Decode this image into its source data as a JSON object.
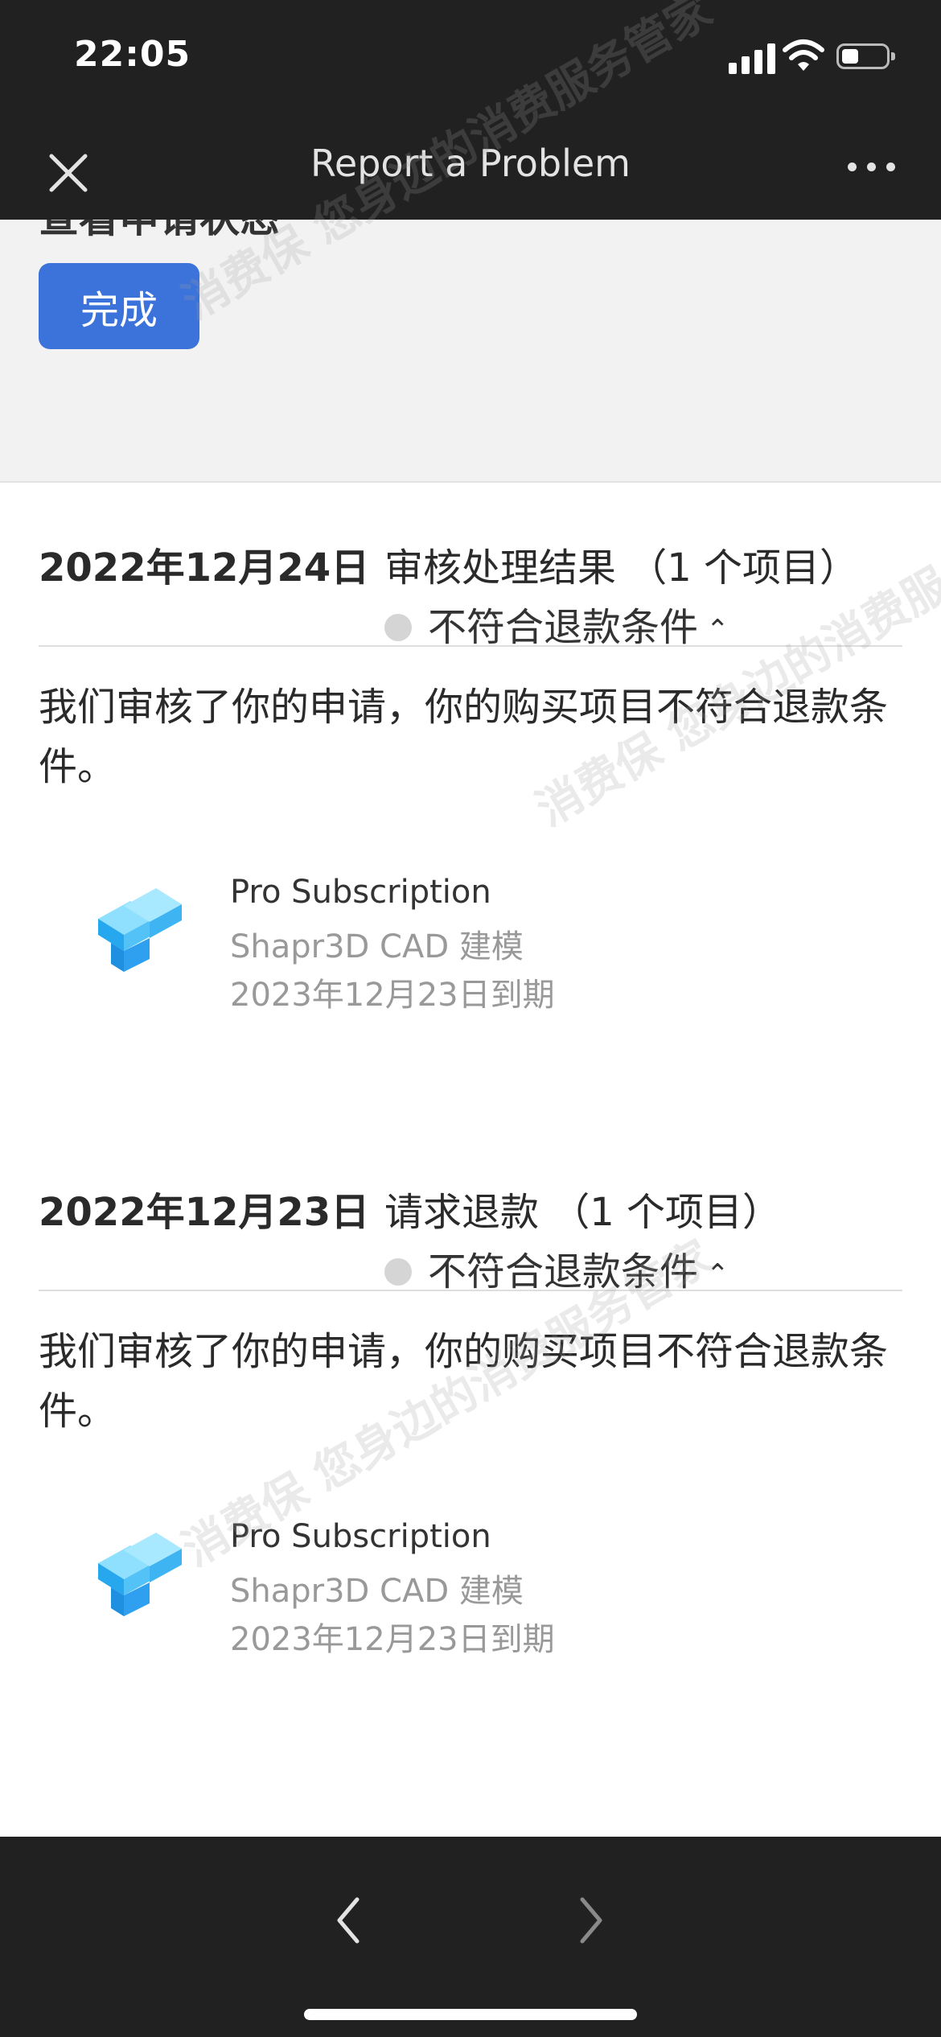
{
  "status_bar": {
    "time": "22:05"
  },
  "nav": {
    "title": "Report a Problem"
  },
  "top_panel": {
    "partial_text": "查看申请状态",
    "done_label": "完成"
  },
  "sections": [
    {
      "date": "2022年12月24日",
      "type": "审核处理结果 （1 个项目）",
      "status": "不符合退款条件",
      "message": "我们审核了你的申请，你的购买项目不符合退款条件。",
      "product": {
        "name": "Pro Subscription",
        "app": "Shapr3D CAD 建模",
        "expiry": "2023年12月23日到期"
      }
    },
    {
      "date": "2022年12月23日",
      "type": "请求退款 （1 个项目）",
      "status": "不符合退款条件",
      "message": "我们审核了你的申请，你的购买项目不符合退款条件。",
      "product": {
        "name": "Pro Subscription",
        "app": "Shapr3D CAD 建模",
        "expiry": "2023年12月23日到期"
      }
    }
  ],
  "watermark": {
    "text": "消费保 您身边的消费服务管家"
  },
  "icons": {
    "close": "close-icon",
    "more": "more-icon",
    "back": "chevron-left-icon",
    "forward": "chevron-right-icon",
    "status_dot": "status-dot-icon",
    "expand": "chevron-up-icon",
    "app": "shapr3d-app-icon"
  },
  "colors": {
    "bars": "#212121",
    "accent": "#3b73da",
    "panel": "#f2f2f2",
    "secondary_text": "#999999"
  }
}
